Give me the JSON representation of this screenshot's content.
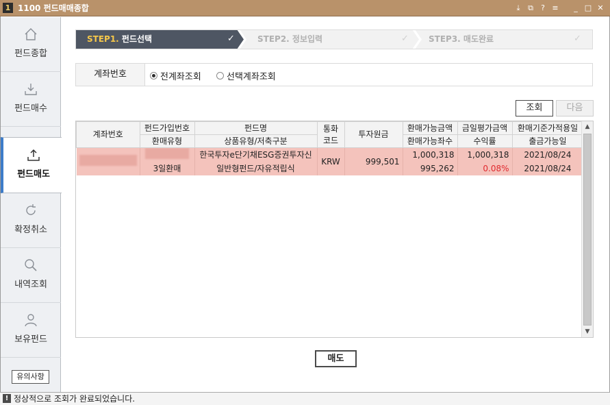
{
  "window": {
    "badge": "1",
    "title": "1100 펀드매매종합",
    "controls": [
      "⤓",
      "⧉",
      "?",
      "≡",
      "_",
      "□",
      "✕"
    ]
  },
  "sidebar": {
    "items": [
      {
        "label": "펀드종합",
        "icon": "home-icon"
      },
      {
        "label": "펀드매수",
        "icon": "download-icon"
      },
      {
        "label": "펀드매도",
        "icon": "upload-icon",
        "active": true
      },
      {
        "label": "확정취소",
        "icon": "refresh-icon"
      },
      {
        "label": "내역조회",
        "icon": "search-icon"
      },
      {
        "label": "보유펀드",
        "icon": "user-icon"
      }
    ],
    "notice_label": "유의사항"
  },
  "steps": [
    {
      "num": "STEP1.",
      "label": "펀드선택",
      "state": "active"
    },
    {
      "num": "STEP2.",
      "label": "정보입력",
      "state": "pending"
    },
    {
      "num": "STEP3.",
      "label": "매도완료",
      "state": "pending"
    }
  ],
  "account": {
    "label": "계좌번호",
    "options": [
      {
        "label": "전계좌조회",
        "selected": true
      },
      {
        "label": "선택계좌조회",
        "selected": false
      }
    ]
  },
  "actions": {
    "search_label": "조회",
    "next_label": "다음",
    "sell_label": "매도"
  },
  "table": {
    "headers": {
      "account": "계좌번호",
      "join_no": "펀드가입번호",
      "redeem_type": "환매유형",
      "fund_name": "펀드명",
      "product_type": "상품유형/저축구분",
      "currency": "통화\n코드",
      "principal": "투자원금",
      "redeemable_amt": "환매가능금액",
      "redeemable_units": "환매가능좌수",
      "eval_amt": "금일평가금액",
      "return_rate": "수익률",
      "nav_date": "환매기준가적용일",
      "payout_date": "출금가능일"
    },
    "rows": [
      {
        "redeem_type": "3일환매",
        "fund_name": "한국투자e단기채ESG증권투자신",
        "product_type": "일반형펀드/자유적립식",
        "currency": "KRW",
        "principal": "999,501",
        "redeemable_amt": "1,000,318",
        "redeemable_units": "995,262",
        "eval_amt": "1,000,318",
        "return_rate": "0.08%",
        "nav_date": "2021/08/24",
        "payout_date": "2021/08/24"
      }
    ]
  },
  "status": {
    "icon": "!",
    "text": "정상적으로 조회가 완료되었습니다."
  },
  "colors": {
    "titlebar": "#b9926a",
    "step_active": "#4e5663",
    "step_active_num": "#f5c74a",
    "selected_row": "#f4c3bc",
    "negative_text": "#e0282d",
    "sidebar_accent": "#3d7cc9"
  }
}
